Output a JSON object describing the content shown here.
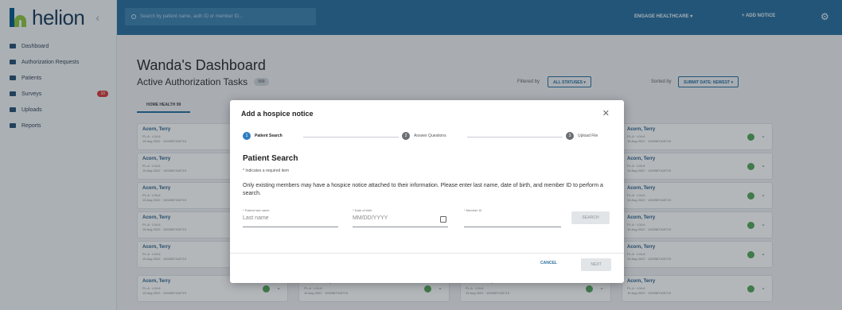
{
  "app": {
    "logo_text": "helion",
    "collapse_icon": "chevron-left-icon"
  },
  "sidebar": {
    "items": [
      {
        "label": "Dashboard",
        "icon": "grid-icon",
        "badge": ""
      },
      {
        "label": "Authorization Requests",
        "icon": "clipboard-icon",
        "badge": ""
      },
      {
        "label": "Patients",
        "icon": "people-icon",
        "badge": ""
      },
      {
        "label": "Surveys",
        "icon": "survey-icon",
        "badge": "10"
      },
      {
        "label": "Uploads",
        "icon": "upload-icon",
        "badge": ""
      },
      {
        "label": "Reports",
        "icon": "chart-icon",
        "badge": ""
      }
    ]
  },
  "topbar": {
    "search_placeholder": "Search by patient name, auth ID or member ID...",
    "org_label": "ENGAGE HEALTHCARE ▾",
    "add_notice_label": "+ ADD NOTICE",
    "settings_icon": "gear-icon"
  },
  "dashboard": {
    "title": "Wanda's Dashboard",
    "tasks_title": "Active Authorization Tasks",
    "tasks_count": "999",
    "filtered_label": "Filtered by",
    "filter_value": "ALL STATUSES ▾",
    "sorted_label": "Sorted by",
    "sort_value": "SUBMIT DATE: NEWEST ▾",
    "tab_label": "HOME HEALTH",
    "tab_count": "99",
    "card": {
      "name": "Acorn, Terry",
      "line1": "PL-A · L04-6",
      "line2": "15 Aug 2022 · 1002987415715"
    }
  },
  "modal": {
    "title": "Add a hospice notice",
    "close_icon": "close-icon",
    "steps": [
      {
        "label": "Patient Search",
        "num": "1"
      },
      {
        "label": "Answer Questions",
        "num": "2"
      },
      {
        "label": "Upload File",
        "num": "3"
      }
    ],
    "section_title": "Patient Search",
    "required_note": "* Indicates a required item",
    "description": "Only existing members may have a hospice notice attached to their information. Please enter last name, date of birth, and member ID to perform a search.",
    "fields": {
      "last_name_label": "* Patient last name",
      "last_name_placeholder": "Last name",
      "dob_label": "* Date of birth",
      "dob_placeholder": "MM/DD/YYYY",
      "member_id_label": "* Member ID",
      "member_id_placeholder": ""
    },
    "search_button": "SEARCH",
    "cancel_button": "CANCEL",
    "next_button": "NEXT"
  },
  "colors": {
    "topbar": "#2b6f9e",
    "accent": "#2d7ec0",
    "brand_green": "#8dc63f",
    "brand_blue": "#0a5a8c",
    "badge_red": "#d73a3a"
  }
}
